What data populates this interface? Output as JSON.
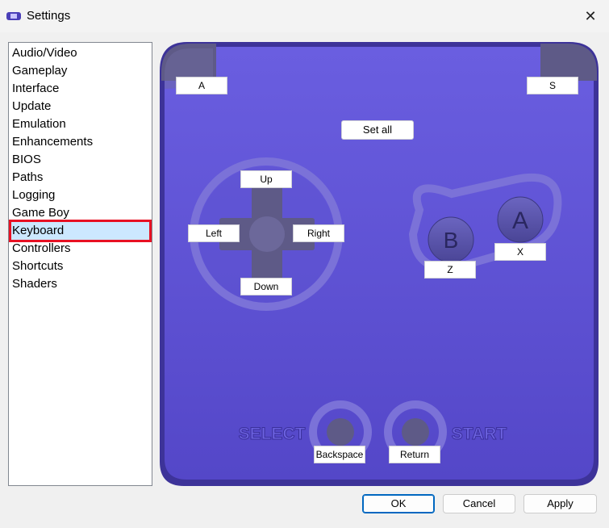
{
  "window": {
    "title": "Settings",
    "close_glyph": "✕"
  },
  "sidebar": {
    "items": [
      {
        "label": "Audio/Video"
      },
      {
        "label": "Gameplay"
      },
      {
        "label": "Interface"
      },
      {
        "label": "Update"
      },
      {
        "label": "Emulation"
      },
      {
        "label": "Enhancements"
      },
      {
        "label": "BIOS"
      },
      {
        "label": "Paths"
      },
      {
        "label": "Logging"
      },
      {
        "label": "Game Boy"
      },
      {
        "label": "Keyboard",
        "selected": true
      },
      {
        "label": "Controllers"
      },
      {
        "label": "Shortcuts"
      },
      {
        "label": "Shaders"
      }
    ]
  },
  "keymap": {
    "l_shoulder": "A",
    "r_shoulder": "S",
    "set_all": "Set all",
    "up": "Up",
    "left": "Left",
    "right": "Right",
    "down": "Down",
    "b": "Z",
    "a": "X",
    "select": "Backspace",
    "start": "Return"
  },
  "gba_labels": {
    "select": "SELECT",
    "start": "START",
    "a": "A",
    "b": "B"
  },
  "buttons": {
    "ok": "OK",
    "cancel": "Cancel",
    "apply": "Apply"
  },
  "colors": {
    "body": "#5a4fd0",
    "body_dark": "#3a2f9a",
    "selection_outline": "#e81123",
    "selection_bg": "#cce8ff"
  }
}
